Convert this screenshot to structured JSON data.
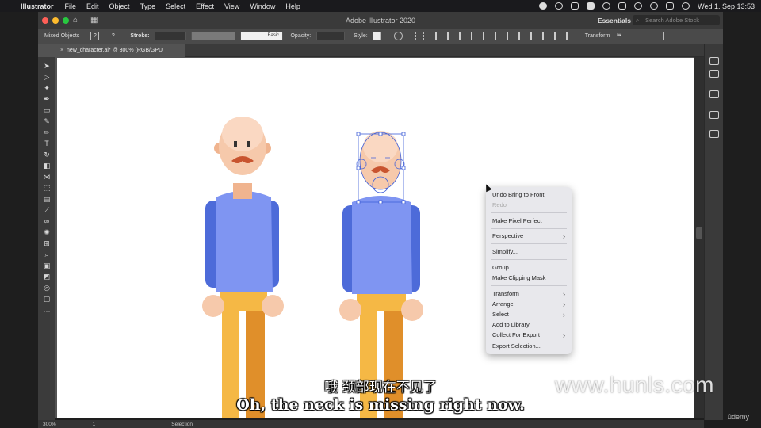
{
  "menubar": {
    "app_name": "Illustrator",
    "items": [
      "File",
      "Edit",
      "Object",
      "Type",
      "Select",
      "Effect",
      "View",
      "Window",
      "Help"
    ],
    "clock": "Wed 1. Sep  13:53"
  },
  "titlebar": {
    "title": "Adobe Illustrator 2020",
    "workspace": "Essentials",
    "search_placeholder": "Search Adobe Stock"
  },
  "controlbar": {
    "selection_label": "Mixed Objects",
    "stroke_label": "Stroke:",
    "brush_label": "Basic",
    "opacity_label": "Opacity:",
    "style_label": "Style:",
    "transform_label": "Transform"
  },
  "document": {
    "tab_label": "new_character.ai* @ 300% (RGB/GPU Preview)"
  },
  "statusbar": {
    "zoom": "300%",
    "artboard_number": "1",
    "tool_name": "Selection"
  },
  "context_menu": {
    "items": [
      {
        "label": "Undo Bring to Front",
        "enabled": true,
        "submenu": false
      },
      {
        "label": "Redo",
        "enabled": false,
        "submenu": false
      },
      {
        "label": "Make Pixel Perfect",
        "enabled": true,
        "submenu": false
      },
      {
        "label": "Perspective",
        "enabled": true,
        "submenu": true
      },
      {
        "label": "Simplify...",
        "enabled": true,
        "submenu": false
      },
      {
        "label": "Group",
        "enabled": true,
        "submenu": false
      },
      {
        "label": "Make Clipping Mask",
        "enabled": true,
        "submenu": false
      },
      {
        "label": "Transform",
        "enabled": true,
        "submenu": true
      },
      {
        "label": "Arrange",
        "enabled": true,
        "submenu": true
      },
      {
        "label": "Select",
        "enabled": true,
        "submenu": true
      },
      {
        "label": "Add to Library",
        "enabled": true,
        "submenu": false
      },
      {
        "label": "Collect For Export",
        "enabled": true,
        "submenu": true
      },
      {
        "label": "Export Selection...",
        "enabled": true,
        "submenu": false
      }
    ]
  },
  "subtitles": {
    "chinese": "哦 颈部现在不见了",
    "english": "Oh, the neck is missing right now."
  },
  "watermark": "www.hunls.com",
  "brand": "ûdemy",
  "colors": {
    "skin": "#f6c9ab",
    "skin_dark": "#f0b48f",
    "shirt": "#7f95f2",
    "shirt_dark": "#4d6bd9",
    "pants": "#f5b845",
    "pants_dark": "#e08f2a",
    "mustache": "#c8542f",
    "selection": "#3f5fd8",
    "artboard": "#ffffff",
    "app_chrome": "#3b3b3b"
  }
}
